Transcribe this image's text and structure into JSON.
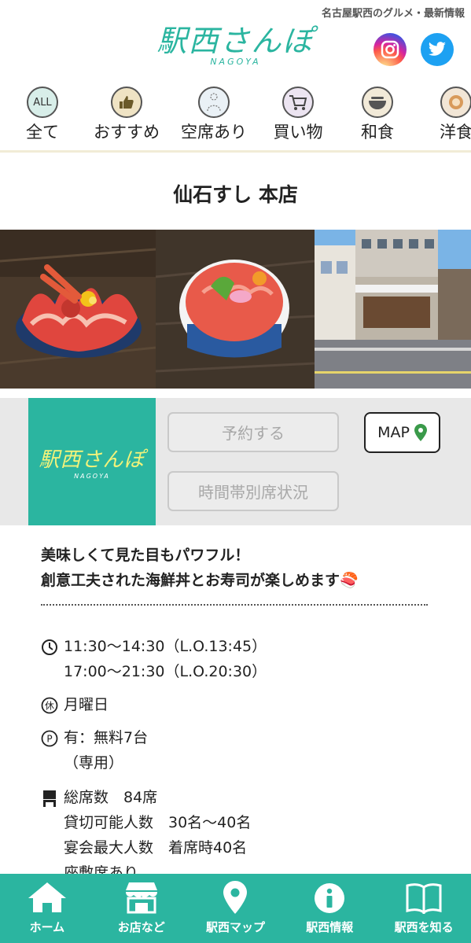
{
  "header": {
    "tagline": "名古屋駅西のグルメ・最新情報",
    "logo_text": "駅西さんぽ",
    "logo_sub": "NAGOYA"
  },
  "categories": [
    {
      "label": "全て",
      "icon": "all-icon",
      "icon_text": "ALL"
    },
    {
      "label": "おすすめ",
      "icon": "thumbs-up-icon"
    },
    {
      "label": "空席あり",
      "icon": "seat-icon"
    },
    {
      "label": "買い物",
      "icon": "cart-icon"
    },
    {
      "label": "和食",
      "icon": "bowl-icon"
    },
    {
      "label": "洋食",
      "icon": "plate-icon"
    }
  ],
  "shop": {
    "title": "仙石すし 本店",
    "photos": [
      "crab-seafood-bowl-photo",
      "tuna-bowl-photo",
      "storefront-photo"
    ]
  },
  "actions": {
    "thumb_logo_text": "駅西さんぽ",
    "thumb_logo_sub": "NAGOYA",
    "reserve_label": "予約する",
    "seat_status_label": "時間帯別席状況",
    "map_label": "MAP"
  },
  "description": {
    "line1": "美味しくて見た目もパワフル！",
    "line2": "創意工夫された海鮮丼とお寿司が楽しめます🍣"
  },
  "info": {
    "hours_line1": "11:30〜14:30（L.O.13:45）",
    "hours_line2": "17:00〜21:30（L.O.20:30）",
    "holiday": "月曜日",
    "parking_line1": "有：無料7台",
    "parking_line2": "（専用）",
    "seats_line1": "総席数　84席",
    "seats_line2": "貸切可能人数　30名〜40名",
    "seats_line3": "宴会最大人数　着席時40名",
    "seats_line4": "座敷席あり"
  },
  "bottom_nav": [
    {
      "label": "ホーム",
      "icon": "home-icon"
    },
    {
      "label": "お店など",
      "icon": "shop-icon"
    },
    {
      "label": "駅西マップ",
      "icon": "map-pin-icon"
    },
    {
      "label": "駅西情報",
      "icon": "info-icon"
    },
    {
      "label": "駅西を知る",
      "icon": "book-icon"
    }
  ],
  "colors": {
    "accent": "#2bb5a0",
    "thumb_logo_text": "#f3f37a",
    "twitter": "#1da1f2",
    "map_pin": "#3a9a4a"
  }
}
